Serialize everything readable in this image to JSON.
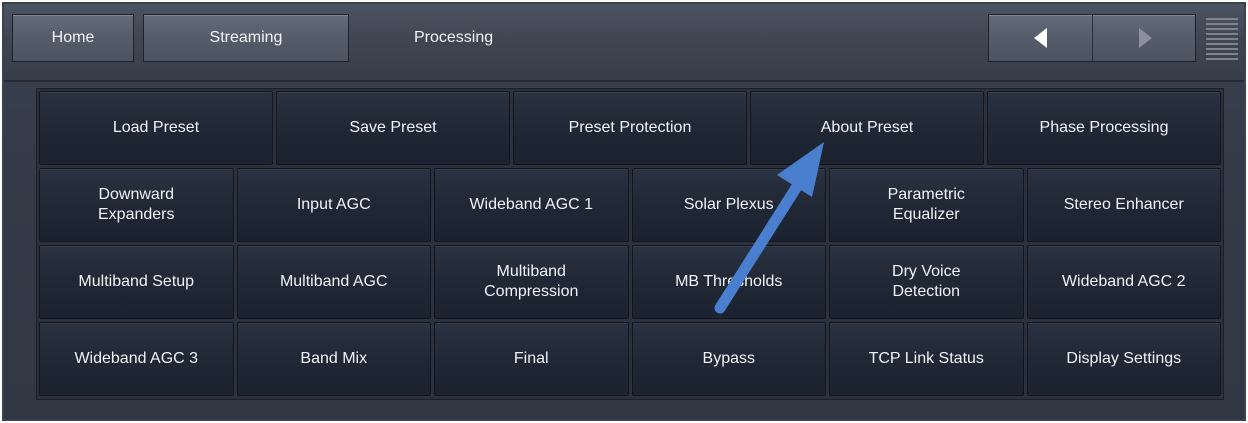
{
  "header": {
    "tabs": [
      {
        "label": "Home"
      },
      {
        "label": "Streaming"
      },
      {
        "label": "Processing"
      }
    ],
    "nav": {
      "back_icon": "triangle-left-icon",
      "forward_icon": "triangle-right-icon",
      "menu_icon": "hamburger-menu-icon"
    }
  },
  "grid": {
    "rows": [
      [
        {
          "label": "Load Preset"
        },
        {
          "label": "Save Preset"
        },
        {
          "label": "Preset Protection"
        },
        {
          "label": "About Preset"
        },
        {
          "label": "Phase Processing"
        }
      ],
      [
        {
          "label": "Downward\nExpanders"
        },
        {
          "label": "Input AGC"
        },
        {
          "label": "Wideband AGC 1"
        },
        {
          "label": "Solar Plexus"
        },
        {
          "label": "Parametric\nEqualizer"
        },
        {
          "label": "Stereo Enhancer"
        }
      ],
      [
        {
          "label": "Multiband Setup"
        },
        {
          "label": "Multiband AGC"
        },
        {
          "label": "Multiband\nCompression"
        },
        {
          "label": "MB Thresholds"
        },
        {
          "label": "Dry Voice\nDetection"
        },
        {
          "label": "Wideband AGC 2"
        }
      ],
      [
        {
          "label": "Wideband AGC 3"
        },
        {
          "label": "Band Mix"
        },
        {
          "label": "Final"
        },
        {
          "label": "Bypass"
        },
        {
          "label": "TCP Link Status"
        },
        {
          "label": "Display Settings"
        }
      ]
    ]
  },
  "annotation": {
    "icon": "callout-arrow-icon",
    "color": "#4a7fd0"
  },
  "colors": {
    "button_bg": "#1f2733",
    "header_bg": "#4d5461",
    "text": "#f0f2f5"
  }
}
